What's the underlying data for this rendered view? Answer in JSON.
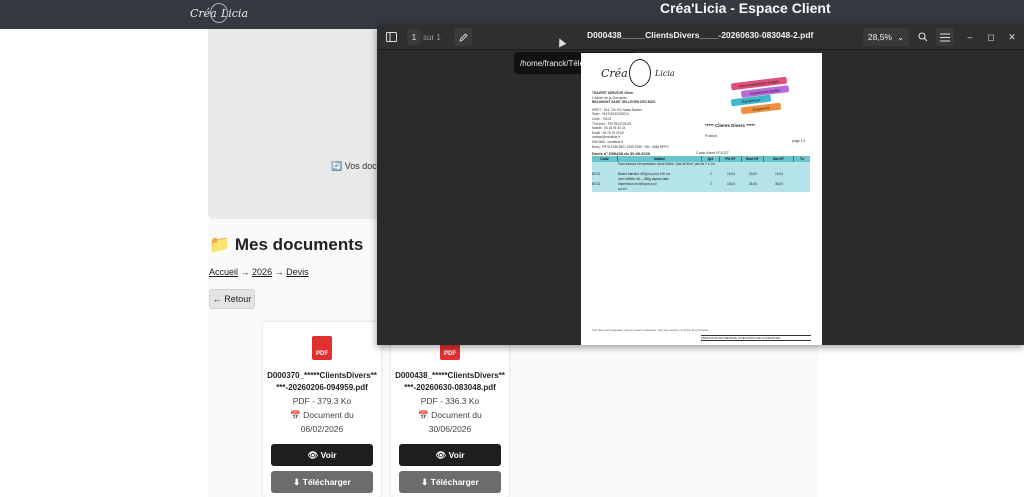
{
  "site": {
    "logo": {
      "first": "Créa",
      "second": "Licia"
    },
    "title": "Créa'Licia - Espace Client"
  },
  "preview": {
    "text": "🔄 Vos docu"
  },
  "documents": {
    "title": "📁 Mes documents",
    "breadcrumb": [
      {
        "label": "Accueil"
      },
      {
        "label": "2026"
      },
      {
        "label": "Devis"
      }
    ],
    "separator": "→",
    "back_label": "← Retour",
    "cards": [
      {
        "icon_label": "PDF",
        "name": "D000370_*****ClientsDivers*****-20260206-094959.pdf",
        "type_size": "PDF - 379.3 Ko",
        "date_line": "📅 Document du",
        "date": "06/02/2026",
        "view_label": "👁 Voir",
        "download_label": "⬇ Télécharger"
      },
      {
        "icon_label": "PDF",
        "name": "D000438_*****ClientsDivers*****-20260630-083048.pdf",
        "type_size": "PDF - 336.3 Ko",
        "date_line": "📅 Document du",
        "date": "30/06/2026",
        "view_label": "👁 Voir",
        "download_label": "⬇ Télécharger"
      }
    ]
  },
  "viewer": {
    "sidebar_icon": "sidebar-icon",
    "page_current": "1",
    "page_of": "sur 1",
    "annotate_icon": "pencil-icon",
    "doc_title": "D000438_____ClientsDivers____-20260630-083048-2.pdf",
    "zoom": "28,5%",
    "zoom_chevron": "⌄",
    "search_icon": "search-icon",
    "menu_icon": "hamburger-menu-icon",
    "minimize": "–",
    "maximize": "◻",
    "close": "✕",
    "tooltip": "/home/franck/Téléchargements"
  },
  "pdf": {
    "logo": {
      "first": "Créa",
      "second": "Licia"
    },
    "company_lines": [
      "TRAVERT KERVEUR Olivia",
      "L'Atelier de la Chenande",
      "BEAUMONT SAINT GELLEGEN DES BOIS",
      "SIRET : 914 726 192 Nadia Nasser",
      "Siren : 914726192000014",
      "Code : 7410Z",
      "TVA Intra : FR73914726192",
      "Mobile : 06 18 05 34 24",
      "Email : 06 78 15 29 00",
      "contact@crealicia.fr",
      "Site Web : creatlicia.fr",
      "Banq : FR76 6788 8901 2345 6789 · Rib : 4548 BPPO"
    ],
    "strips": [
      {
        "text": "Personnalisations d'objets",
        "color": "#e0507c"
      },
      {
        "text": "Impressions textiles",
        "color": "#b86ad8"
      },
      {
        "text": "Signalétique",
        "color": "#3fb8d0"
      },
      {
        "text": "Graphisme",
        "color": "#f0903c"
      }
    ],
    "client_name": "***** Clients Divers *****",
    "client_country": "France",
    "devis_title": "Devis n° D00438 du 30.06.2026",
    "devis_code": "Code client N°1027",
    "devis_page": "page 1/1",
    "columns": [
      "Code",
      "Intitulé",
      "Qté",
      "PU HT",
      "Brut HT",
      "Net HT",
      "Tx"
    ],
    "rows": [
      [
        "",
        "Tous travaux et impression d'une bâche \"pas de frise\" pas de 7 x 1m",
        "",
        "",
        "",
        "",
        ""
      ],
      [
        "",
        "",
        "",
        "",
        "",
        "",
        ""
      ],
      [
        "BCG1",
        "Bâche blanche 420g/m² pour 100 cm",
        "2",
        "15,00",
        "30,00",
        "15,00",
        ""
      ],
      [
        "",
        "avec œillets 4m – 360g aspect satin",
        "",
        "",
        "",
        "",
        ""
      ],
      [
        "BCG1",
        "Impression numérique pour",
        "2",
        "18,00",
        "36,00",
        "36,00",
        ""
      ],
      [
        "",
        "au m2",
        "",
        "",
        "",
        "",
        ""
      ]
    ],
    "footer_left": "Tous devis par la signature, avec la mention manuscrite « bon pour accord » ou le bon de commande",
    "footer_right": "PRESTATION ENTREPRISE ATTESTATION DE FOURNITURE"
  }
}
